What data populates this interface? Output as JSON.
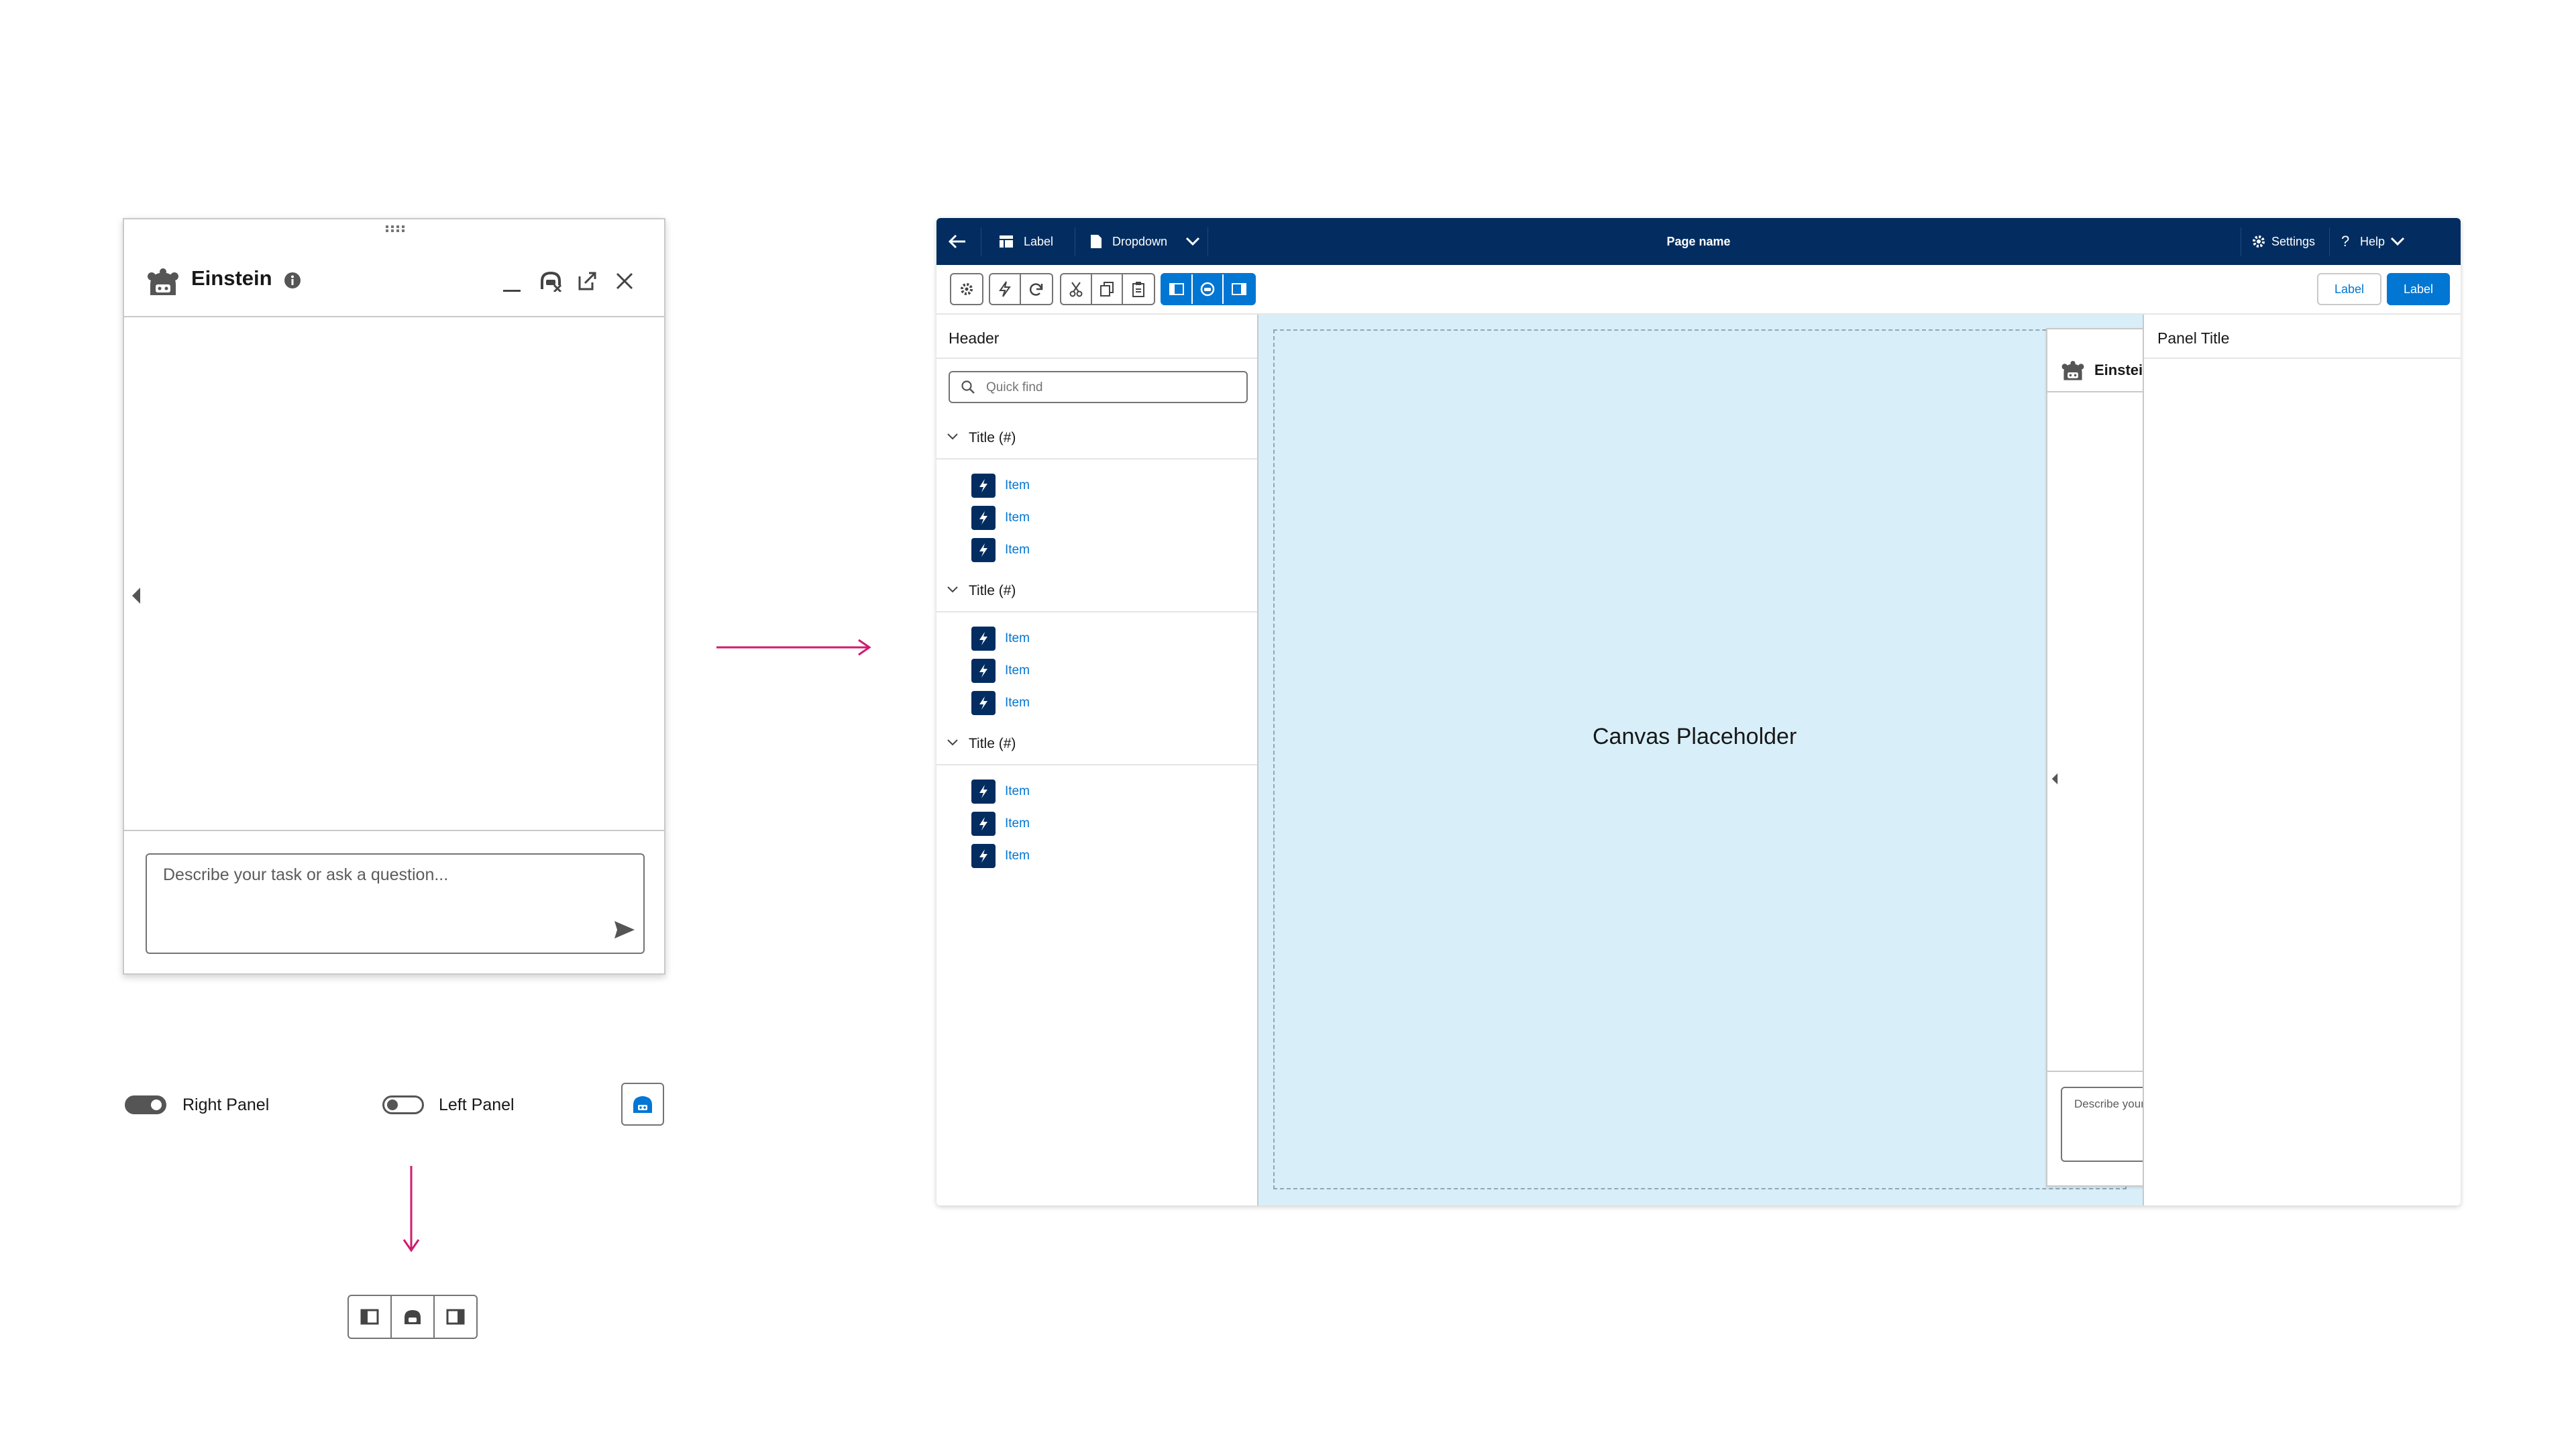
{
  "floating_panel": {
    "title": "Einstein",
    "input_placeholder": "Describe your task or ask a question..."
  },
  "toggles": {
    "right_panel_label": "Right Panel",
    "right_panel_on": true,
    "left_panel_label": "Left Panel",
    "left_panel_on": false
  },
  "app": {
    "topbar": {
      "label": "Label",
      "dropdown": "Dropdown",
      "page_name": "Page name",
      "settings": "Settings",
      "help": "Help"
    },
    "toolbar": {
      "neutral_button": "Label",
      "brand_button": "Label"
    },
    "left_nav": {
      "header": "Header",
      "search_placeholder": "Quick find",
      "sections": [
        {
          "title": "Title (#)",
          "items": [
            "Item",
            "Item",
            "Item"
          ]
        },
        {
          "title": "Title (#)",
          "items": [
            "Item",
            "Item",
            "Item"
          ]
        },
        {
          "title": "Title (#)",
          "items": [
            "Item",
            "Item",
            "Item"
          ]
        }
      ]
    },
    "canvas": {
      "placeholder": "Canvas Placeholder"
    },
    "docked_panel": {
      "title": "Einstein",
      "input_placeholder": "Describe your task or ask a question..."
    },
    "right_panel": {
      "title": "Panel Title"
    }
  },
  "colors": {
    "navy": "#032d60",
    "brand": "#0176d3",
    "canvas_bg": "#d8eff9",
    "arrow": "#d01b6e"
  },
  "icons": [
    "einstein-icon",
    "info-icon",
    "minimize-icon",
    "einstein-off-icon",
    "popout-icon",
    "close-icon",
    "send-icon",
    "back-arrow-icon",
    "table-icon",
    "document-icon",
    "chevron-down-icon",
    "gear-icon",
    "question-icon",
    "lightning-icon",
    "redo-icon",
    "cut-icon",
    "copy-icon",
    "paste-icon",
    "left-panel-icon",
    "right-panel-icon",
    "search-icon",
    "grip-icon"
  ]
}
